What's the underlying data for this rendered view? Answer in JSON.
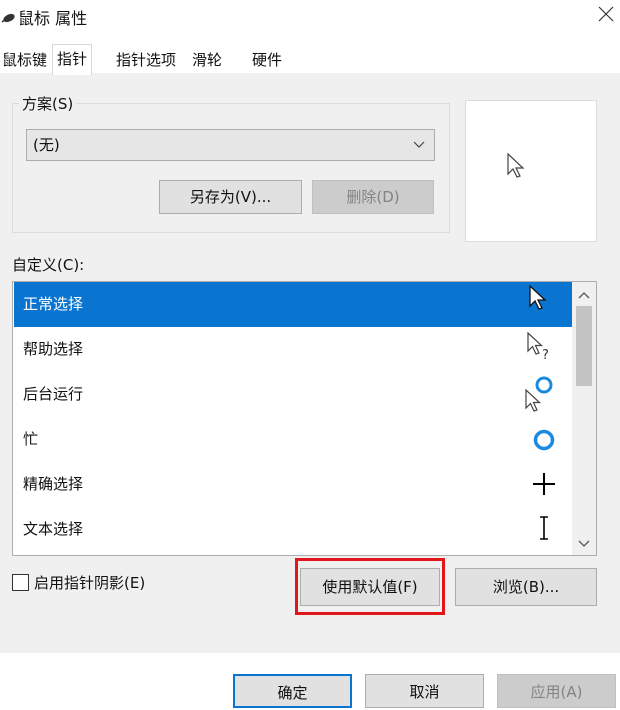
{
  "window": {
    "title": "鼠标 属性",
    "icon": "mouse-icon"
  },
  "tabs": [
    {
      "label": "鼠标键"
    },
    {
      "label": "指针"
    },
    {
      "label": "指针选项"
    },
    {
      "label": "滑轮"
    },
    {
      "label": "硬件"
    }
  ],
  "scheme": {
    "label": "方案(S)",
    "value": "(无)",
    "save_as_label": "另存为(V)...",
    "delete_label": "删除(D)"
  },
  "customize": {
    "label": "自定义(C):",
    "items": [
      {
        "label": "正常选择",
        "cursor": "arrow-cursor-icon"
      },
      {
        "label": "帮助选择",
        "cursor": "help-cursor-icon"
      },
      {
        "label": "后台运行",
        "cursor": "working-cursor-icon"
      },
      {
        "label": "忙",
        "cursor": "busy-cursor-icon"
      },
      {
        "label": "精确选择",
        "cursor": "crosshair-cursor-icon"
      },
      {
        "label": "文本选择",
        "cursor": "text-cursor-icon"
      }
    ]
  },
  "options": {
    "shadow_label": "启用指针阴影(E)",
    "default_label": "使用默认值(F)",
    "browse_label": "浏览(B)..."
  },
  "footer": {
    "ok_label": "确定",
    "cancel_label": "取消",
    "apply_label": "应用(A)"
  },
  "colors": {
    "selection": "#0a75d1",
    "highlight": "#e0161b",
    "busy_ring": "#1a8ae0"
  }
}
